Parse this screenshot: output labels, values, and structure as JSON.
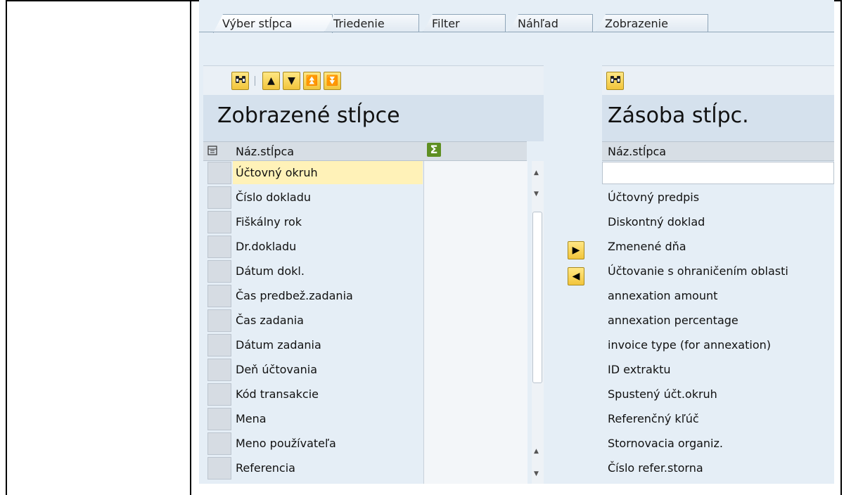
{
  "tabs": [
    "Výber stĺpca",
    "Triedenie",
    "Filter",
    "Náhľad",
    "Zobrazenie"
  ],
  "left_panel": {
    "title": "Zobrazené stĺpce",
    "column_header": "Náz.stĺpca",
    "sum_icon": "Σ",
    "rows": [
      "Účtovný okruh",
      "Číslo dokladu",
      "Fiškálny rok",
      "Dr.dokladu",
      "Dátum dokl.",
      "Čas predbež.zadania",
      "Čas zadania",
      "Dátum zadania",
      "Deň účtovania",
      "Kód transakcie",
      "Mena",
      "Meno používateľa",
      "Referencia"
    ]
  },
  "right_panel": {
    "title": "Zásoba stĺpc.",
    "column_header": "Náz.stĺpca",
    "rows": [
      "",
      "Účtovný predpis",
      "Diskontný doklad",
      "Zmenené dňa",
      "Účtovanie s ohraničením oblasti",
      "annexation amount",
      "annexation percentage",
      "invoice type (for annexation)",
      "ID extraktu",
      "Spustený účt.okruh",
      "Referenčný kľúč",
      "Stornovacia organiz.",
      "Číslo refer.storna"
    ]
  },
  "icons": {
    "find": "binoculars-icon",
    "up": "▲",
    "down": "▼",
    "top": "⏫",
    "bottom": "⏬",
    "move_right": "▶",
    "move_left": "◀"
  },
  "colors": {
    "button_yellow": "#f2c53b",
    "highlight": "#fff2b8",
    "panel_bg": "#e5eef6"
  }
}
